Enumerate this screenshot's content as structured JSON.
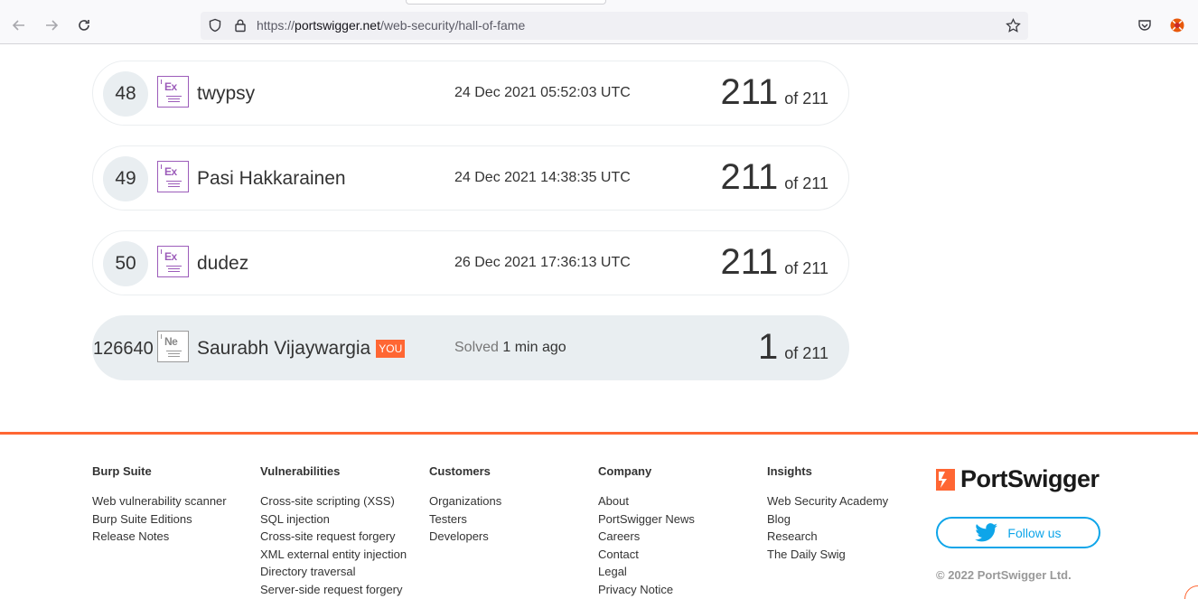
{
  "browser": {
    "url_scheme": "https://",
    "url_host": "portswigger.net",
    "url_path": "/web-security/hall-of-fame",
    "icons": [
      "back-arrow-icon",
      "forward-arrow-icon",
      "reload-icon",
      "shield-icon",
      "lock-icon",
      "star-icon",
      "pocket-icon",
      "extension-icon"
    ]
  },
  "leaderboard": {
    "rows": [
      {
        "rank": "48",
        "badge": "Ex",
        "name": "twypsy",
        "date": "24 Dec 2021 05:52:03 UTC",
        "score": "211",
        "of": "of 211"
      },
      {
        "rank": "49",
        "badge": "Ex",
        "name": "Pasi Hakkarainen",
        "date": "24 Dec 2021 14:38:35 UTC",
        "score": "211",
        "of": "of 211"
      },
      {
        "rank": "50",
        "badge": "Ex",
        "name": "dudez",
        "date": "26 Dec 2021 17:36:13 UTC",
        "score": "211",
        "of": "of 211"
      }
    ],
    "you": {
      "rank": "126640",
      "badge": "Ne",
      "name": "Saurabh Vijaywargia",
      "tag": "YOU",
      "solved_label": "Solved",
      "solved_time": "1 min ago",
      "score": "1",
      "of": "of 211"
    }
  },
  "footer": {
    "columns": [
      {
        "heading": "Burp Suite",
        "links": [
          "Web vulnerability scanner",
          "Burp Suite Editions",
          "Release Notes"
        ]
      },
      {
        "heading": "Vulnerabilities",
        "links": [
          "Cross-site scripting (XSS)",
          "SQL injection",
          "Cross-site request forgery",
          "XML external entity injection",
          "Directory traversal",
          "Server-side request forgery"
        ]
      },
      {
        "heading": "Customers",
        "links": [
          "Organizations",
          "Testers",
          "Developers"
        ]
      },
      {
        "heading": "Company",
        "links": [
          "About",
          "PortSwigger News",
          "Careers",
          "Contact",
          "Legal",
          "Privacy Notice"
        ]
      },
      {
        "heading": "Insights",
        "links": [
          "Web Security Academy",
          "Blog",
          "Research",
          "The Daily Swig"
        ]
      }
    ],
    "logo_text": "PortSwigger",
    "follow_label": "Follow us",
    "copyright": "© 2022 PortSwigger Ltd."
  },
  "colors": {
    "accent": "#ff6633",
    "twitter": "#0ea5e9",
    "badge_expert": "#9c5cba"
  }
}
